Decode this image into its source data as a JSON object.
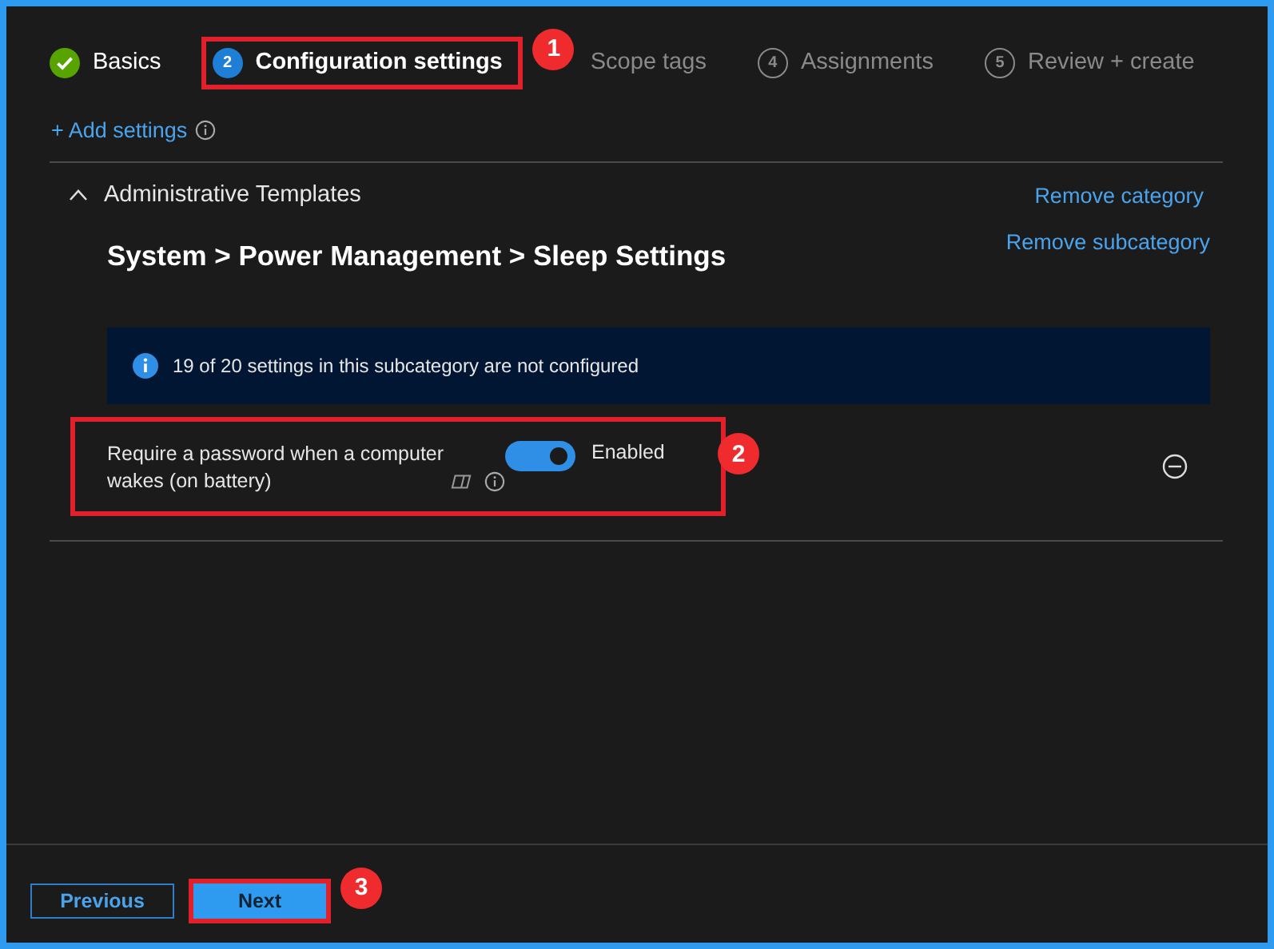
{
  "steps": [
    {
      "kind": "done",
      "label": "Basics",
      "highlighted": false
    },
    {
      "kind": "current",
      "number": "2",
      "label": "Configuration settings",
      "highlighted": true,
      "badge": "1"
    },
    {
      "kind": "pending",
      "label": "Scope tags",
      "highlighted": false
    },
    {
      "kind": "pending",
      "number": "4",
      "label": "Assignments",
      "highlighted": false
    },
    {
      "kind": "pending",
      "number": "5",
      "label": "Review + create",
      "highlighted": false
    }
  ],
  "add_settings": "+ Add settings",
  "category": {
    "title": "Administrative Templates",
    "expanded": true,
    "remove_link": "Remove category",
    "subcategory": {
      "title": "System > Power Management > Sleep Settings",
      "remove_link": "Remove subcategory",
      "info": "19 of 20 settings in this subcategory are not configured",
      "settings": [
        {
          "label": "Require a password when a computer wakes (on battery)",
          "on": true,
          "value": "Enabled",
          "highlighted": true,
          "badge": "2"
        }
      ]
    }
  },
  "footer": {
    "buttons": [
      {
        "label": "Previous",
        "kind": "secondary",
        "highlighted": false
      },
      {
        "label": "Next",
        "kind": "primary",
        "highlighted": true,
        "badge": "3"
      }
    ]
  }
}
